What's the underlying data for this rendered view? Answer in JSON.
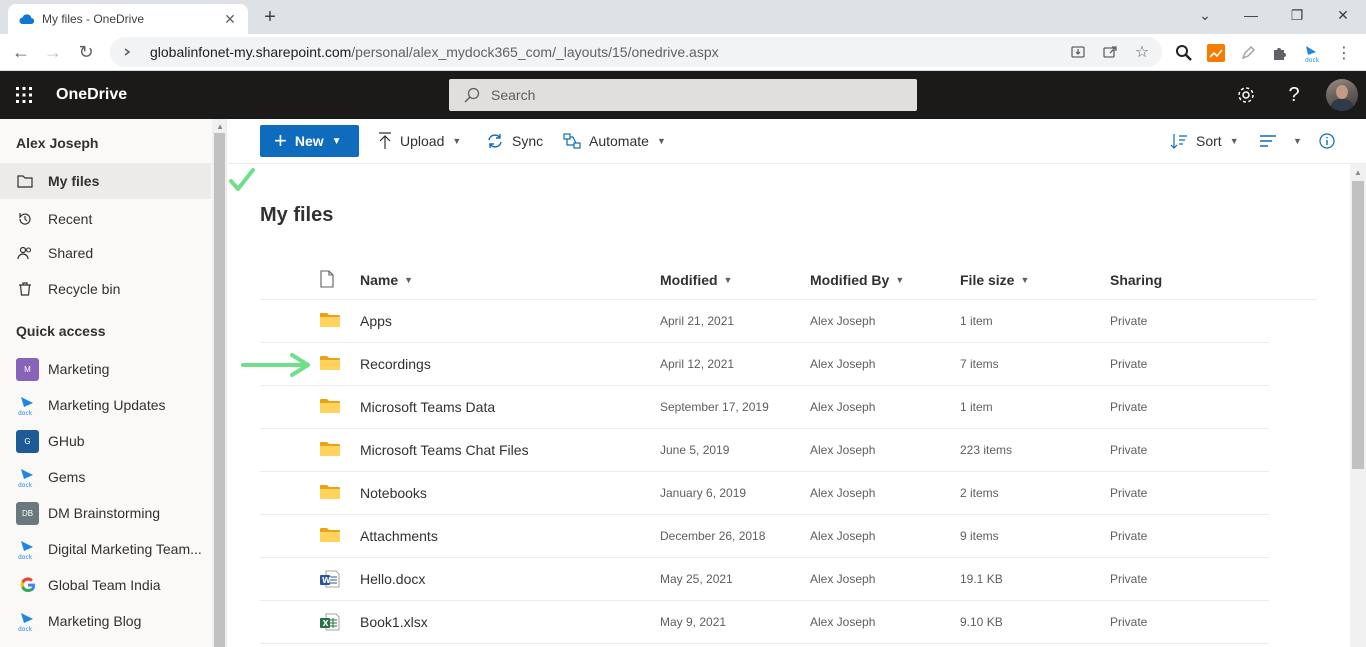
{
  "browser": {
    "tab_title": "My files - OneDrive",
    "url_host": "globalinfonet-my.sharepoint.com",
    "url_path": "/personal/alex_mydock365_com/_layouts/15/onedrive.aspx"
  },
  "suite": {
    "app_name": "OneDrive",
    "search_placeholder": "Search"
  },
  "leftnav": {
    "user": "Alex Joseph",
    "items": [
      {
        "label": "My files",
        "icon": "folder-icon",
        "selected": true
      },
      {
        "label": "Recent",
        "icon": "history-icon"
      },
      {
        "label": "Shared",
        "icon": "people-icon"
      },
      {
        "label": "Recycle bin",
        "icon": "trash-icon"
      }
    ],
    "quick_access_title": "Quick access",
    "sites": [
      {
        "label": "Marketing",
        "badge": "M",
        "color": "#8764b8"
      },
      {
        "label": "Marketing Updates",
        "badge": "dock",
        "color": "dock"
      },
      {
        "label": "GHub",
        "badge": "G",
        "color": "#1e5a96"
      },
      {
        "label": "Gems",
        "badge": "dock",
        "color": "dock"
      },
      {
        "label": "DM Brainstorming",
        "badge": "DB",
        "color": "#69797e"
      },
      {
        "label": "Digital Marketing Team...",
        "badge": "dock",
        "color": "dock"
      },
      {
        "label": "Global Team India",
        "badge": "G-logo",
        "color": "google"
      },
      {
        "label": "Marketing Blog",
        "badge": "dock",
        "color": "dock"
      }
    ]
  },
  "commands": {
    "new": "New",
    "upload": "Upload",
    "sync": "Sync",
    "automate": "Automate",
    "sort": "Sort"
  },
  "page": {
    "title": "My files"
  },
  "table": {
    "columns": {
      "name": "Name",
      "modified": "Modified",
      "modified_by": "Modified By",
      "file_size": "File size",
      "sharing": "Sharing"
    },
    "rows": [
      {
        "type": "folder",
        "name": "Apps",
        "modified": "April 21, 2021",
        "modified_by": "Alex Joseph",
        "size": "1 item",
        "sharing": "Private"
      },
      {
        "type": "folder",
        "name": "Recordings",
        "modified": "April 12, 2021",
        "modified_by": "Alex Joseph",
        "size": "7 items",
        "sharing": "Private"
      },
      {
        "type": "folder",
        "name": "Microsoft Teams Data",
        "modified": "September 17, 2019",
        "modified_by": "Alex Joseph",
        "size": "1 item",
        "sharing": "Private"
      },
      {
        "type": "folder",
        "name": "Microsoft Teams Chat Files",
        "modified": "June 5, 2019",
        "modified_by": "Alex Joseph",
        "size": "223 items",
        "sharing": "Private"
      },
      {
        "type": "folder",
        "name": "Notebooks",
        "modified": "January 6, 2019",
        "modified_by": "Alex Joseph",
        "size": "2 items",
        "sharing": "Private"
      },
      {
        "type": "folder",
        "name": "Attachments",
        "modified": "December 26, 2018",
        "modified_by": "Alex Joseph",
        "size": "9 items",
        "sharing": "Private"
      },
      {
        "type": "word",
        "name": "Hello.docx",
        "modified": "May 25, 2021",
        "modified_by": "Alex Joseph",
        "size": "19.1 KB",
        "sharing": "Private"
      },
      {
        "type": "excel",
        "name": "Book1.xlsx",
        "modified": "May 9, 2021",
        "modified_by": "Alex Joseph",
        "size": "9.10 KB",
        "sharing": "Private"
      }
    ]
  },
  "colors": {
    "accent": "#0f6cbd",
    "suite_bar": "#1b1a19",
    "folder": "#ffd35c",
    "annotation": "#6fe08a"
  }
}
